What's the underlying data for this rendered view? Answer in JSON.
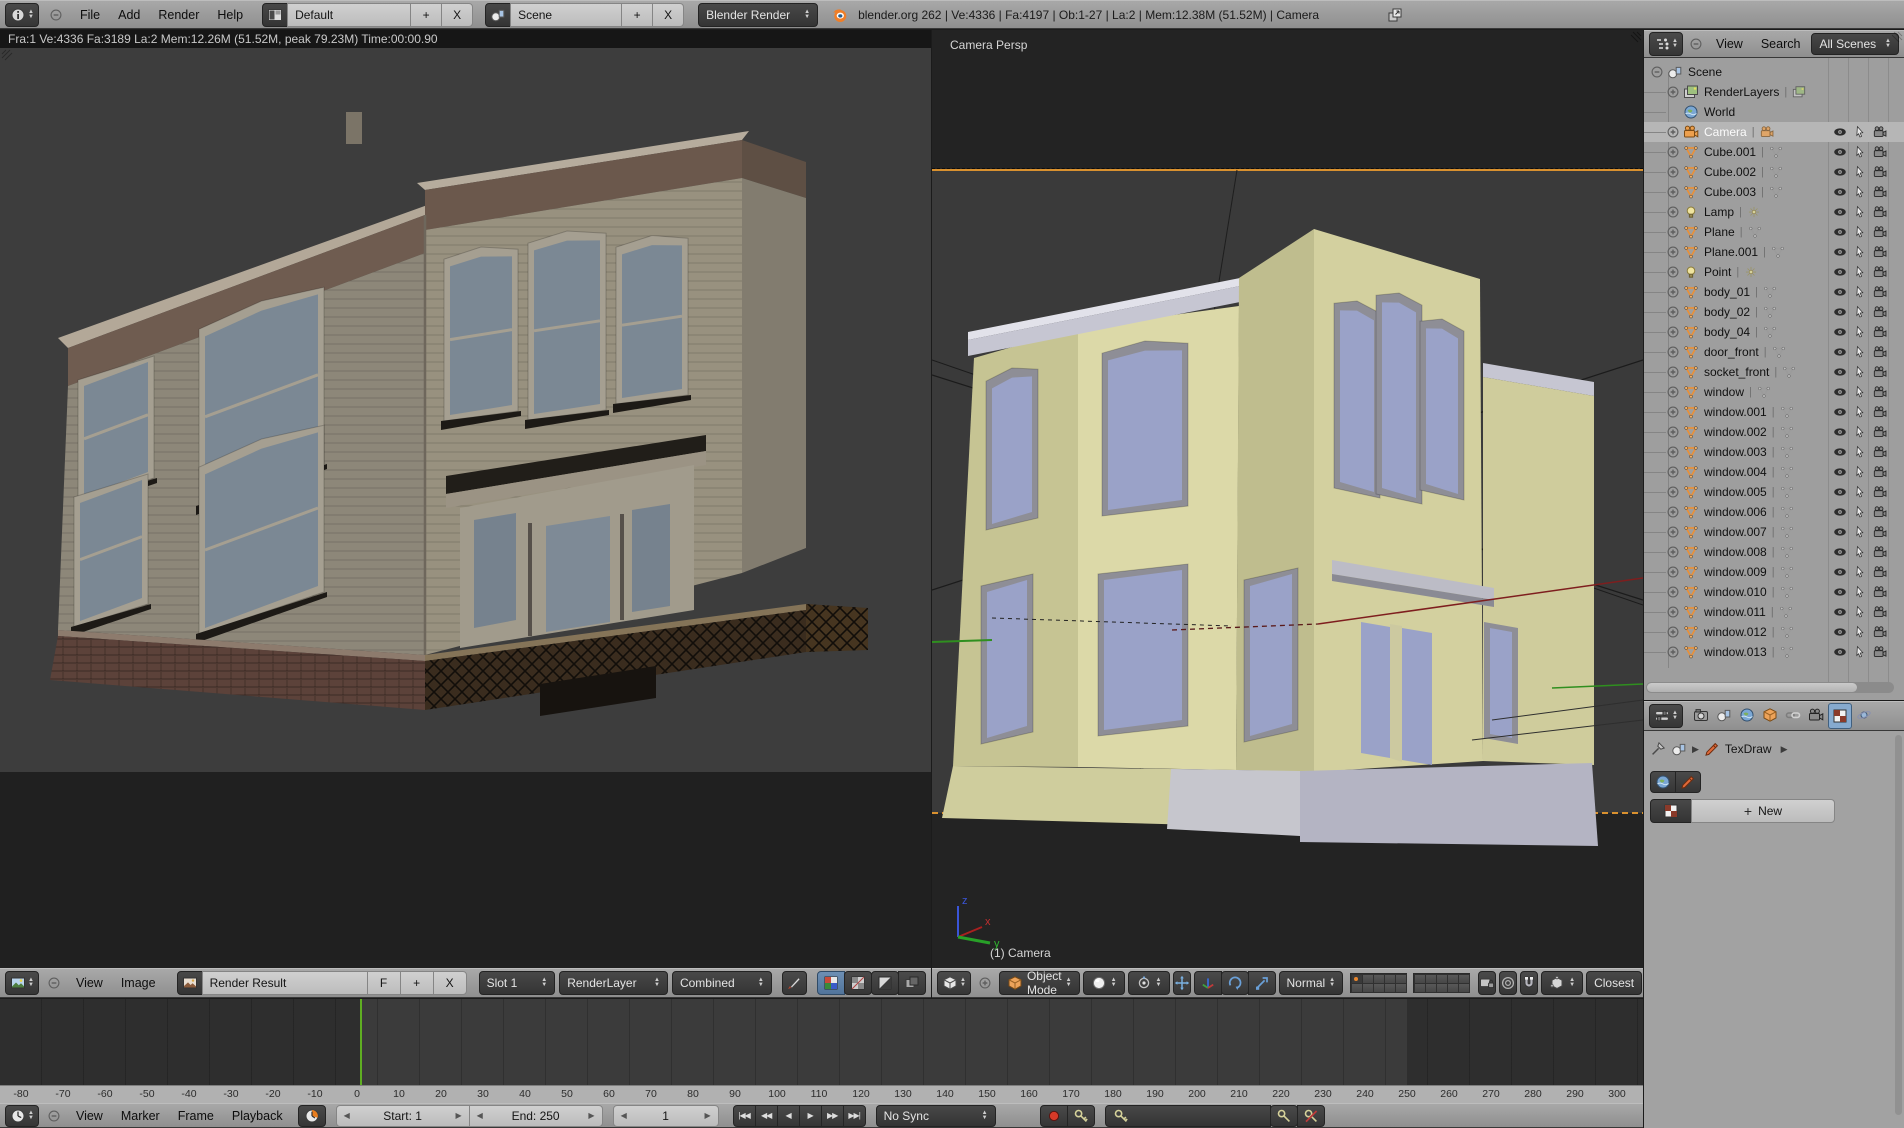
{
  "colors": {
    "accent_orange": "#e8862d",
    "selection_green": "#5fae22",
    "camera_border": "#d9912f",
    "viewport_bg": "#232323",
    "camera_view_bg": "#3a3a3a",
    "model_khaki": "#d6d3a2",
    "model_glass": "#9aa2c8",
    "outliner_bg": "#9e9e9e",
    "header_gray": "#9c9c9c"
  },
  "icons": [
    "info-editor",
    "image-editor",
    "view3d-editor",
    "outliner-editor",
    "properties-editor",
    "timeline-editor",
    "screen-layout",
    "blender-logo",
    "duplicate-window",
    "minus",
    "plus",
    "scene",
    "layers",
    "world",
    "camera",
    "mesh",
    "lamp",
    "lamp-data",
    "eye",
    "cursor",
    "camera-toggle",
    "render-tab",
    "object-cube",
    "constraints-link",
    "texture-checker",
    "physics",
    "pin",
    "brush",
    "paint-brush",
    "checker-color",
    "checker-alpha",
    "alpha",
    "z-buffer",
    "shading-sphere",
    "pivot",
    "manipulator",
    "translate-axes",
    "rotate",
    "scale",
    "lock-camera",
    "proportional",
    "magnet",
    "snap-element",
    "clock",
    "record",
    "keyframe",
    "keyframe-insert",
    "keyframe-delete",
    "image-datablock"
  ],
  "top_header": {
    "menus": [
      "File",
      "Add",
      "Render",
      "Help"
    ],
    "layout_name": "Default",
    "scene_name": "Scene",
    "engine": "Blender Render",
    "add": "+",
    "close": "X",
    "stats": "blender.org 262 | Ve:4336 | Fa:4197 | Ob:1-27 | La:2 | Mem:12.38M (51.52M) | Camera"
  },
  "image_editor": {
    "render_stats": "Fra:1  Ve:4336 Fa:3189 La:2 Mem:12.26M (51.52M, peak 79.23M) Time:00:00.90",
    "menus": [
      "View",
      "Image"
    ],
    "datablock": "Render Result",
    "fake_user": "F",
    "add": "+",
    "close": "X",
    "slot": "Slot 1",
    "layer": "RenderLayer",
    "render_pass": "Combined"
  },
  "viewport": {
    "view_label": "Camera Persp",
    "camera_label": "(1) Camera",
    "mode": "Object Mode",
    "orientation": "Normal",
    "snap_target": "Closest",
    "axis": {
      "x": "x",
      "y": "y",
      "z": "z"
    }
  },
  "outliner": {
    "menus": [
      "View",
      "Search"
    ],
    "scene_filter": "All Scenes",
    "items": [
      {
        "name": "Scene",
        "icon": "scene",
        "depth": 0,
        "expander": "minus",
        "toggles": false
      },
      {
        "name": "RenderLayers",
        "icon": "layers",
        "depth": 1,
        "expander": "plus",
        "data_icon": "layers",
        "toggles": false
      },
      {
        "name": "World",
        "icon": "world",
        "depth": 1,
        "expander": "none",
        "toggles": false
      },
      {
        "name": "Camera",
        "icon": "camera",
        "depth": 1,
        "expander": "plus",
        "data_icon": "camera",
        "selected": true,
        "toggles": true
      },
      {
        "name": "Cube.001",
        "icon": "mesh",
        "depth": 1,
        "expander": "plus",
        "data_icon": "mesh",
        "toggles": true
      },
      {
        "name": "Cube.002",
        "icon": "mesh",
        "depth": 1,
        "expander": "plus",
        "data_icon": "mesh",
        "toggles": true
      },
      {
        "name": "Cube.003",
        "icon": "mesh",
        "depth": 1,
        "expander": "plus",
        "data_icon": "mesh",
        "toggles": true
      },
      {
        "name": "Lamp",
        "icon": "lamp",
        "depth": 1,
        "expander": "plus",
        "data_icon": "lamp-data",
        "toggles": true
      },
      {
        "name": "Plane",
        "icon": "mesh",
        "depth": 1,
        "expander": "plus",
        "data_icon": "mesh",
        "toggles": true
      },
      {
        "name": "Plane.001",
        "icon": "mesh",
        "depth": 1,
        "expander": "plus",
        "data_icon": "mesh",
        "toggles": true
      },
      {
        "name": "Point",
        "icon": "lamp",
        "depth": 1,
        "expander": "plus",
        "data_icon": "lamp-data",
        "toggles": true
      },
      {
        "name": "body_01",
        "icon": "mesh",
        "depth": 1,
        "expander": "plus",
        "data_icon": "mesh",
        "toggles": true
      },
      {
        "name": "body_02",
        "icon": "mesh",
        "depth": 1,
        "expander": "plus",
        "data_icon": "mesh",
        "toggles": true
      },
      {
        "name": "body_04",
        "icon": "mesh",
        "depth": 1,
        "expander": "plus",
        "data_icon": "mesh",
        "toggles": true
      },
      {
        "name": "door_front",
        "icon": "mesh",
        "depth": 1,
        "expander": "plus",
        "data_icon": "mesh",
        "toggles": true
      },
      {
        "name": "socket_front",
        "icon": "mesh",
        "depth": 1,
        "expander": "plus",
        "data_icon": "mesh",
        "toggles": true
      },
      {
        "name": "window",
        "icon": "mesh",
        "depth": 1,
        "expander": "plus",
        "data_icon": "mesh",
        "toggles": true
      },
      {
        "name": "window.001",
        "icon": "mesh",
        "depth": 1,
        "expander": "plus",
        "data_icon": "mesh",
        "toggles": true
      },
      {
        "name": "window.002",
        "icon": "mesh",
        "depth": 1,
        "expander": "plus",
        "data_icon": "mesh",
        "toggles": true
      },
      {
        "name": "window.003",
        "icon": "mesh",
        "depth": 1,
        "expander": "plus",
        "data_icon": "mesh",
        "toggles": true
      },
      {
        "name": "window.004",
        "icon": "mesh",
        "depth": 1,
        "expander": "plus",
        "data_icon": "mesh",
        "toggles": true
      },
      {
        "name": "window.005",
        "icon": "mesh",
        "depth": 1,
        "expander": "plus",
        "data_icon": "mesh",
        "toggles": true
      },
      {
        "name": "window.006",
        "icon": "mesh",
        "depth": 1,
        "expander": "plus",
        "data_icon": "mesh",
        "toggles": true
      },
      {
        "name": "window.007",
        "icon": "mesh",
        "depth": 1,
        "expander": "plus",
        "data_icon": "mesh",
        "toggles": true
      },
      {
        "name": "window.008",
        "icon": "mesh",
        "depth": 1,
        "expander": "plus",
        "data_icon": "mesh",
        "toggles": true
      },
      {
        "name": "window.009",
        "icon": "mesh",
        "depth": 1,
        "expander": "plus",
        "data_icon": "mesh",
        "toggles": true
      },
      {
        "name": "window.010",
        "icon": "mesh",
        "depth": 1,
        "expander": "plus",
        "data_icon": "mesh",
        "toggles": true
      },
      {
        "name": "window.011",
        "icon": "mesh",
        "depth": 1,
        "expander": "plus",
        "data_icon": "mesh",
        "toggles": true
      },
      {
        "name": "window.012",
        "icon": "mesh",
        "depth": 1,
        "expander": "plus",
        "data_icon": "mesh",
        "toggles": true
      },
      {
        "name": "window.013",
        "icon": "mesh",
        "depth": 1,
        "expander": "plus",
        "data_icon": "mesh",
        "toggles": true
      }
    ]
  },
  "properties": {
    "tabs": [
      "render",
      "scene",
      "world",
      "object",
      "constraints",
      "object-data",
      "texture",
      "physics"
    ],
    "active_tab": "texture",
    "texture_name": "TexDraw",
    "new_button": "New",
    "context_toggles": [
      "world-texture",
      "brush-texture"
    ]
  },
  "timeline": {
    "menus": [
      "View",
      "Marker",
      "Frame",
      "Playback"
    ],
    "start": "Start: 1",
    "end": "End: 250",
    "current_frame": "1",
    "sync": "No Sync",
    "playback": [
      "|◀◀",
      "◀◀",
      "◀",
      "▶",
      "▶▶",
      "▶▶|"
    ],
    "frame_start": 1,
    "frame_end": 250,
    "ruler_ticks": [
      -80,
      -70,
      -60,
      -50,
      -40,
      -30,
      -20,
      -10,
      0,
      10,
      20,
      30,
      40,
      50,
      60,
      70,
      80,
      90,
      100,
      110,
      120,
      130,
      140,
      150,
      160,
      170,
      180,
      190,
      200,
      210,
      220,
      230,
      240,
      250,
      260,
      270,
      280,
      290,
      300
    ]
  }
}
